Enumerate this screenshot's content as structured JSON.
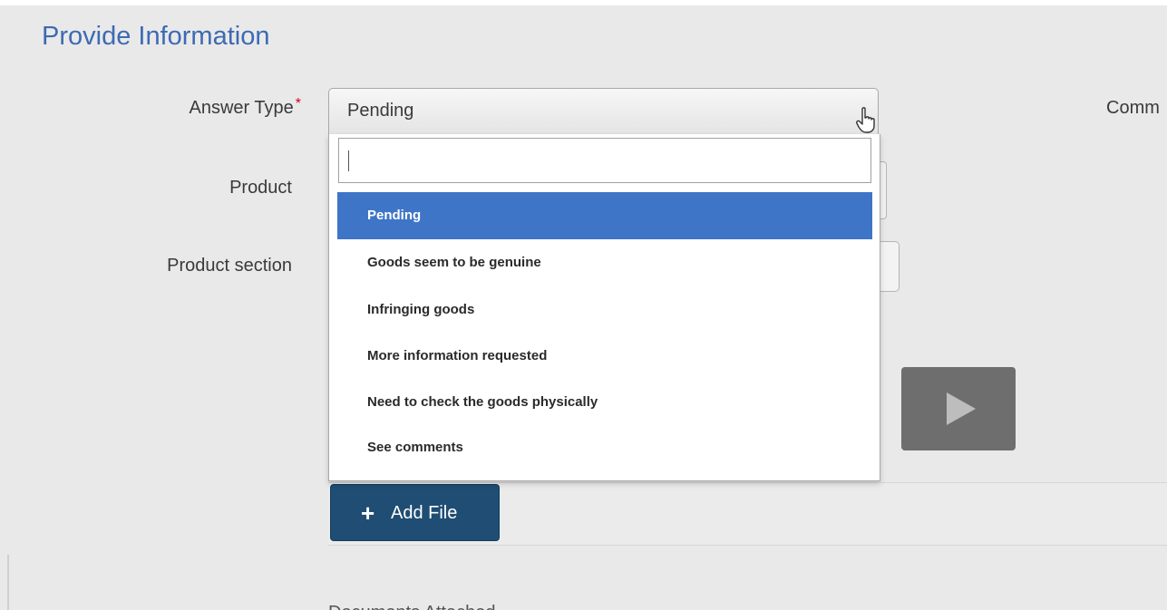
{
  "page": {
    "title": "Provide Information"
  },
  "form": {
    "answer_type_label": "Answer Type",
    "required_marker": "*",
    "product_label": "Product",
    "product_section_label": "Product section",
    "comments_label_partial": "Comm",
    "answer_type_value": "Pending",
    "search_value": ""
  },
  "dropdown": {
    "options": [
      {
        "label": "Pending",
        "selected": true
      },
      {
        "label": "Goods seem to be genuine",
        "selected": false
      },
      {
        "label": "Infringing goods",
        "selected": false
      },
      {
        "label": "More information requested",
        "selected": false
      },
      {
        "label": "Need to check the goods physically",
        "selected": false
      },
      {
        "label": "See comments",
        "selected": false
      }
    ]
  },
  "files": {
    "add_label": "Add File",
    "add_icon": "plus-icon"
  },
  "media": {
    "play_icon": "play-icon"
  },
  "colors": {
    "title": "#3d6ab3",
    "selected_option_bg": "#3f75c7",
    "add_button_bg": "#1f4d73",
    "required": "#d0021b"
  },
  "bottom_partial_text": "Documents Attached"
}
